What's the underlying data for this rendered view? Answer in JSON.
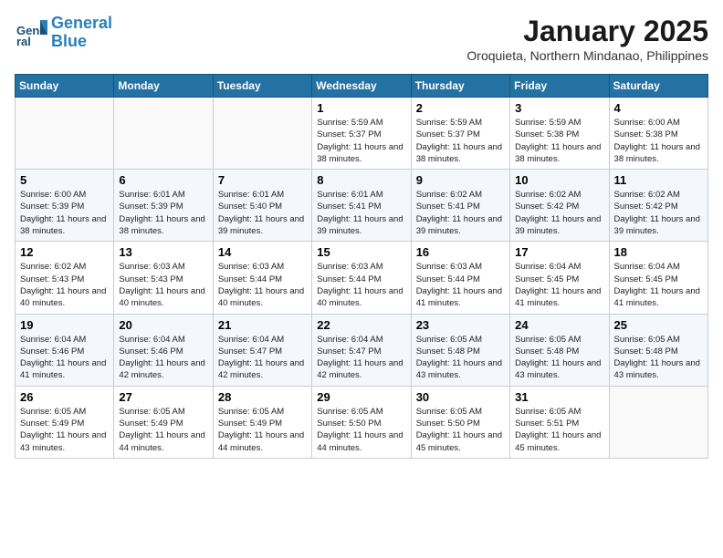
{
  "header": {
    "logo_line1": "General",
    "logo_line2": "Blue",
    "title": "January 2025",
    "location": "Oroquieta, Northern Mindanao, Philippines"
  },
  "weekdays": [
    "Sunday",
    "Monday",
    "Tuesday",
    "Wednesday",
    "Thursday",
    "Friday",
    "Saturday"
  ],
  "weeks": [
    [
      {
        "day": "",
        "info": ""
      },
      {
        "day": "",
        "info": ""
      },
      {
        "day": "",
        "info": ""
      },
      {
        "day": "1",
        "info": "Sunrise: 5:59 AM\nSunset: 5:37 PM\nDaylight: 11 hours and 38 minutes."
      },
      {
        "day": "2",
        "info": "Sunrise: 5:59 AM\nSunset: 5:37 PM\nDaylight: 11 hours and 38 minutes."
      },
      {
        "day": "3",
        "info": "Sunrise: 5:59 AM\nSunset: 5:38 PM\nDaylight: 11 hours and 38 minutes."
      },
      {
        "day": "4",
        "info": "Sunrise: 6:00 AM\nSunset: 5:38 PM\nDaylight: 11 hours and 38 minutes."
      }
    ],
    [
      {
        "day": "5",
        "info": "Sunrise: 6:00 AM\nSunset: 5:39 PM\nDaylight: 11 hours and 38 minutes."
      },
      {
        "day": "6",
        "info": "Sunrise: 6:01 AM\nSunset: 5:39 PM\nDaylight: 11 hours and 38 minutes."
      },
      {
        "day": "7",
        "info": "Sunrise: 6:01 AM\nSunset: 5:40 PM\nDaylight: 11 hours and 39 minutes."
      },
      {
        "day": "8",
        "info": "Sunrise: 6:01 AM\nSunset: 5:41 PM\nDaylight: 11 hours and 39 minutes."
      },
      {
        "day": "9",
        "info": "Sunrise: 6:02 AM\nSunset: 5:41 PM\nDaylight: 11 hours and 39 minutes."
      },
      {
        "day": "10",
        "info": "Sunrise: 6:02 AM\nSunset: 5:42 PM\nDaylight: 11 hours and 39 minutes."
      },
      {
        "day": "11",
        "info": "Sunrise: 6:02 AM\nSunset: 5:42 PM\nDaylight: 11 hours and 39 minutes."
      }
    ],
    [
      {
        "day": "12",
        "info": "Sunrise: 6:02 AM\nSunset: 5:43 PM\nDaylight: 11 hours and 40 minutes."
      },
      {
        "day": "13",
        "info": "Sunrise: 6:03 AM\nSunset: 5:43 PM\nDaylight: 11 hours and 40 minutes."
      },
      {
        "day": "14",
        "info": "Sunrise: 6:03 AM\nSunset: 5:44 PM\nDaylight: 11 hours and 40 minutes."
      },
      {
        "day": "15",
        "info": "Sunrise: 6:03 AM\nSunset: 5:44 PM\nDaylight: 11 hours and 40 minutes."
      },
      {
        "day": "16",
        "info": "Sunrise: 6:03 AM\nSunset: 5:44 PM\nDaylight: 11 hours and 41 minutes."
      },
      {
        "day": "17",
        "info": "Sunrise: 6:04 AM\nSunset: 5:45 PM\nDaylight: 11 hours and 41 minutes."
      },
      {
        "day": "18",
        "info": "Sunrise: 6:04 AM\nSunset: 5:45 PM\nDaylight: 11 hours and 41 minutes."
      }
    ],
    [
      {
        "day": "19",
        "info": "Sunrise: 6:04 AM\nSunset: 5:46 PM\nDaylight: 11 hours and 41 minutes."
      },
      {
        "day": "20",
        "info": "Sunrise: 6:04 AM\nSunset: 5:46 PM\nDaylight: 11 hours and 42 minutes."
      },
      {
        "day": "21",
        "info": "Sunrise: 6:04 AM\nSunset: 5:47 PM\nDaylight: 11 hours and 42 minutes."
      },
      {
        "day": "22",
        "info": "Sunrise: 6:04 AM\nSunset: 5:47 PM\nDaylight: 11 hours and 42 minutes."
      },
      {
        "day": "23",
        "info": "Sunrise: 6:05 AM\nSunset: 5:48 PM\nDaylight: 11 hours and 43 minutes."
      },
      {
        "day": "24",
        "info": "Sunrise: 6:05 AM\nSunset: 5:48 PM\nDaylight: 11 hours and 43 minutes."
      },
      {
        "day": "25",
        "info": "Sunrise: 6:05 AM\nSunset: 5:48 PM\nDaylight: 11 hours and 43 minutes."
      }
    ],
    [
      {
        "day": "26",
        "info": "Sunrise: 6:05 AM\nSunset: 5:49 PM\nDaylight: 11 hours and 43 minutes."
      },
      {
        "day": "27",
        "info": "Sunrise: 6:05 AM\nSunset: 5:49 PM\nDaylight: 11 hours and 44 minutes."
      },
      {
        "day": "28",
        "info": "Sunrise: 6:05 AM\nSunset: 5:49 PM\nDaylight: 11 hours and 44 minutes."
      },
      {
        "day": "29",
        "info": "Sunrise: 6:05 AM\nSunset: 5:50 PM\nDaylight: 11 hours and 44 minutes."
      },
      {
        "day": "30",
        "info": "Sunrise: 6:05 AM\nSunset: 5:50 PM\nDaylight: 11 hours and 45 minutes."
      },
      {
        "day": "31",
        "info": "Sunrise: 6:05 AM\nSunset: 5:51 PM\nDaylight: 11 hours and 45 minutes."
      },
      {
        "day": "",
        "info": ""
      }
    ]
  ]
}
